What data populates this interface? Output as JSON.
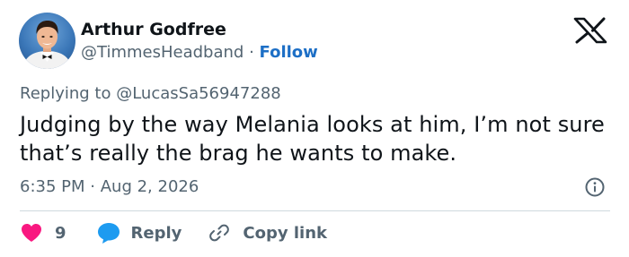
{
  "author": {
    "name": "Arthur Godfree",
    "handle": "@TimmesHeadband",
    "separator": "·",
    "follow_label": "Follow"
  },
  "reply_context": {
    "prefix": "Replying to",
    "mention": "@LucasSa56947288"
  },
  "tweet": {
    "text": "Judging by the way Melania looks at him, I’m not sure that’s really the brag he wants to make."
  },
  "meta": {
    "time": "6:35 PM",
    "separator": "·",
    "date": "Aug 2, 2026"
  },
  "actions": {
    "like_count": "9",
    "reply_label": "Reply",
    "copy_link_label": "Copy link"
  },
  "colors": {
    "like": "#f91880",
    "reply": "#1d9bf0",
    "link": "#1d6fc6",
    "muted": "#536471"
  },
  "icons": {
    "platform": "x-logo-icon",
    "info": "info-icon",
    "like": "heart-icon",
    "reply": "speech-bubble-icon",
    "copy": "link-icon"
  }
}
